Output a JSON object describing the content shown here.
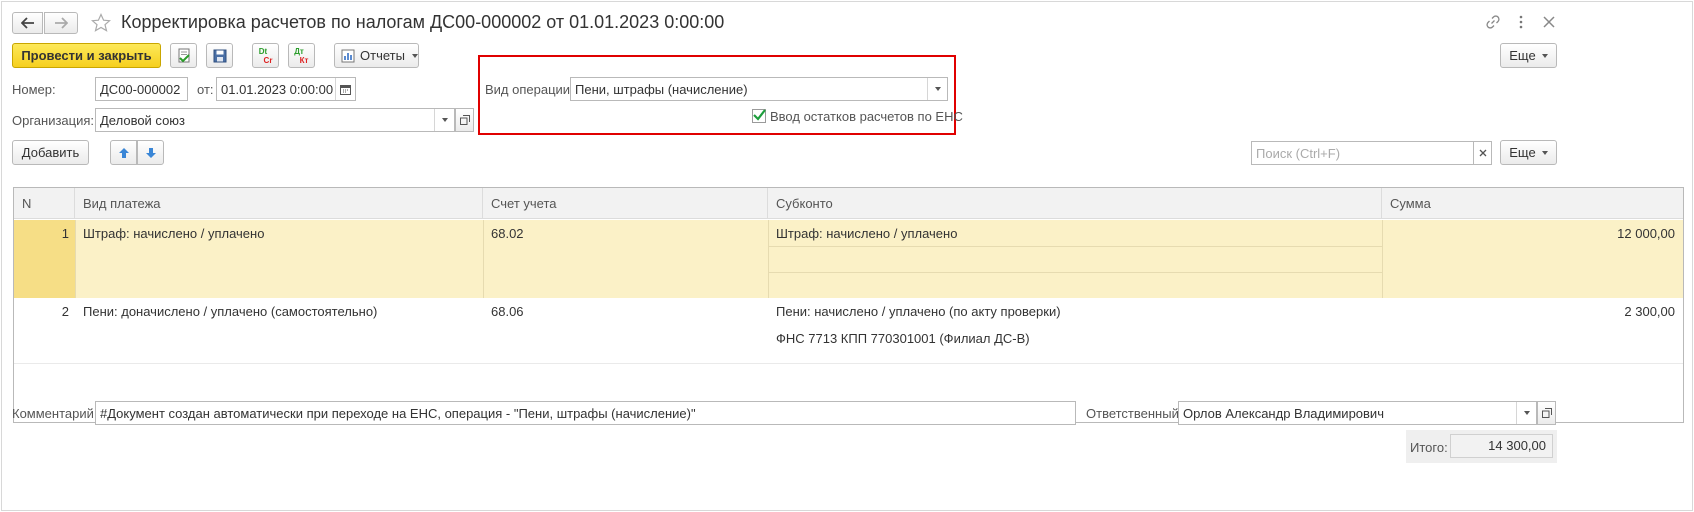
{
  "window": {
    "title": "Корректировка расчетов по налогам ДС00-000002 от 01.01.2023 0:00:00"
  },
  "toolbar": {
    "post_close": "Провести и закрыть",
    "reports": "Отчеты",
    "more": "Еще",
    "dt_label_top": "Dt",
    "dt_label_bottom": "Cr",
    "dk_label_top": "Дт",
    "dk_label_bottom": "Кт"
  },
  "form": {
    "number_label": "Номер:",
    "number_value": "ДС00-000002",
    "date_label": "от:",
    "date_value": "01.01.2023  0:00:00",
    "org_label": "Организация:",
    "org_value": "Деловой союз",
    "op_label": "Вид операции:",
    "op_value": "Пени, штрафы (начисление)",
    "ens_checkbox_label": "Ввод остатков расчетов по ЕНС",
    "ens_checked": true
  },
  "table_toolbar": {
    "add": "Добавить",
    "search_placeholder": "Поиск (Ctrl+F)",
    "more": "Еще"
  },
  "table": {
    "headers": [
      "N",
      "Вид платежа",
      "Счет учета",
      "Субконто",
      "Сумма"
    ],
    "rows": [
      {
        "n": "1",
        "payment": "Штраф: начислено / уплачено",
        "account": "68.02",
        "sub1": "Штраф: начислено / уплачено",
        "sub2": "",
        "amount": "12 000,00"
      },
      {
        "n": "2",
        "payment": "Пени: доначислено / уплачено (самостоятельно)",
        "account": "68.06",
        "sub1": "Пени: начислено / уплачено (по акту проверки)",
        "sub2": "ФНС 7713 КПП 770301001 (Филиал ДС-В)",
        "amount": "2 300,00"
      }
    ]
  },
  "footer": {
    "comment_label": "Комментарий:",
    "comment_value": "#Документ создан автоматически при переходе на ЕНС, операция - \"Пени, штрафы (начисление)\"",
    "resp_label": "Ответственный:",
    "resp_value": "Орлов Александр Владимирович",
    "total_label": "Итого:",
    "total_value": "14 300,00"
  },
  "colors": {
    "highlight_box": "#e00000",
    "selected_row": "#fbf1c7",
    "primary_button": "#f6cf1e"
  }
}
